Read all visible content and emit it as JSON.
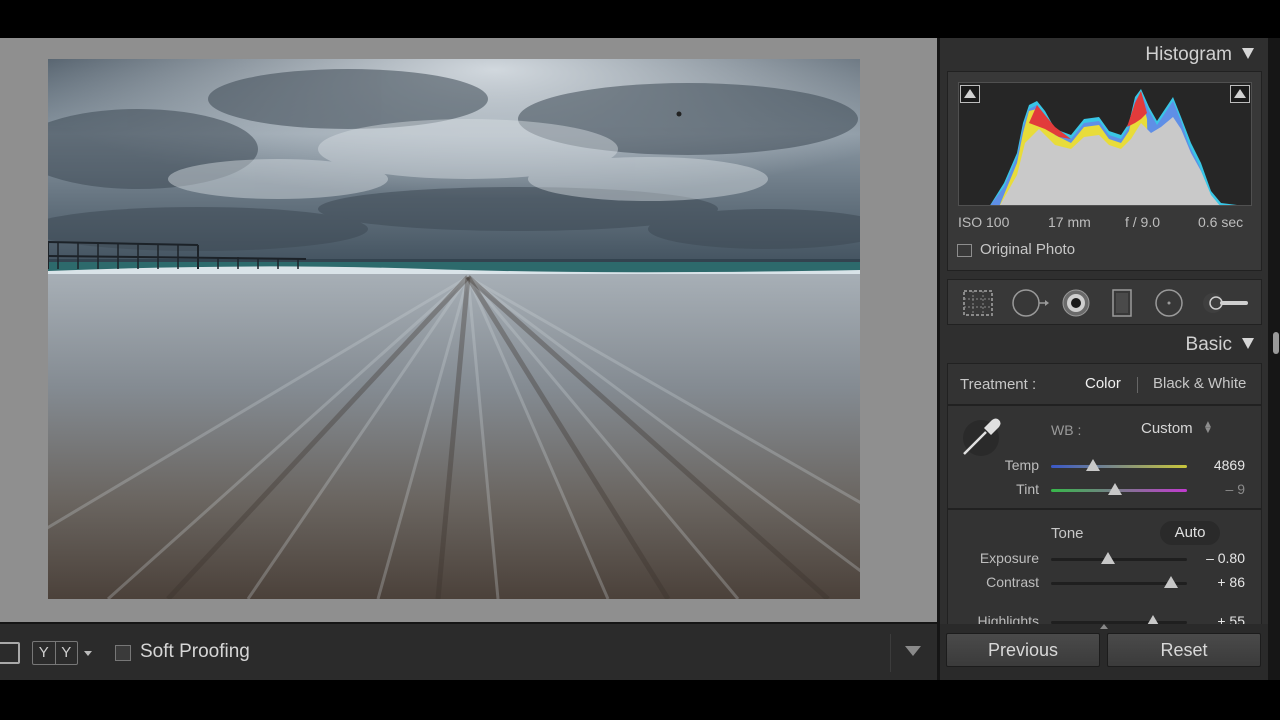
{
  "toolbar": {
    "yy_left": "Y",
    "yy_right": "Y",
    "soft_proofing_label": "Soft Proofing"
  },
  "histogram": {
    "title": "Histogram",
    "iso": "ISO 100",
    "focal_length": "17 mm",
    "aperture": "f / 9.0",
    "shutter": "0.6 sec",
    "original_photo_label": "Original Photo"
  },
  "basic": {
    "title": "Basic",
    "treatment_label": "Treatment :",
    "treatment_color": "Color",
    "treatment_bw": "Black & White",
    "wb_label": "WB :",
    "wb_value": "Custom",
    "tone_label": "Tone",
    "auto_label": "Auto",
    "sliders": [
      {
        "label": "Temp",
        "value": "4869",
        "position": 0.31
      },
      {
        "label": "Tint",
        "value": "– 9",
        "position": 0.47
      },
      {
        "label": "Exposure",
        "value": "– 0.80",
        "position": 0.42
      },
      {
        "label": "Contrast",
        "value": "+ 86",
        "position": 0.88
      },
      {
        "label": "Highlights",
        "value": "+ 55",
        "position": 0.75
      }
    ]
  },
  "buttons": {
    "previous": "Previous",
    "reset": "Reset"
  },
  "colors": {
    "panel_bg": "#2f2f2f",
    "canvas_bg": "#8f8f8f",
    "histogram_red": "#e23b3b",
    "histogram_yellow": "#e8dc3a",
    "histogram_blue": "#5f8fe6",
    "histogram_cyan": "#39c6e6"
  }
}
